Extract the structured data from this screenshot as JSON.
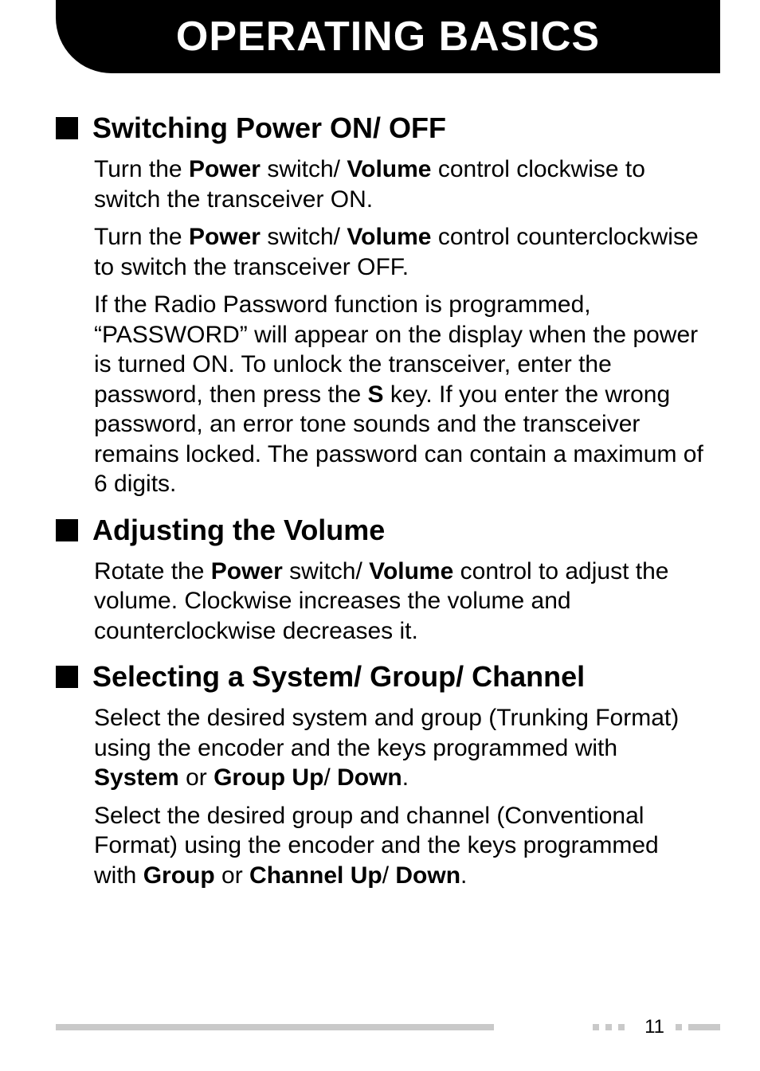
{
  "header": {
    "title": "OPERATING BASICS"
  },
  "sections": [
    {
      "heading": "Switching Power ON/ OFF",
      "paragraphs": [
        "Turn the <b>Power</b> switch/ <b>Volume</b> control clockwise to switch the transceiver ON.",
        "Turn the <b>Power</b> switch/ <b>Volume</b> control counterclockwise to switch the transceiver OFF.",
        "If the Radio Password function is programmed, “PASSWORD” will appear on the display when the power is turned ON.  To unlock the transceiver, enter the password, then press the <b>S</b> key.  If you enter the wrong password, an error tone sounds and the transceiver remains locked.  The password can contain a maximum of 6 digits."
      ]
    },
    {
      "heading": "Adjusting the Volume",
      "paragraphs": [
        "Rotate the <b>Power</b> switch/ <b>Volume</b> control to adjust the volume.  Clockwise increases the volume and counterclockwise decreases it."
      ]
    },
    {
      "heading": "Selecting a System/ Group/ Channel",
      "paragraphs": [
        "Select the desired system and group (Trunking Format) using the encoder and the keys programmed with <b>System</b> or <b>Group Up</b>/ <b>Down</b>.",
        "Select the desired group and channel (Conventional Format) using the encoder and the keys programmed with <b>Group</b> or <b>Channel Up</b>/ <b>Down</b>."
      ]
    }
  ],
  "footer": {
    "page_number": "11"
  }
}
